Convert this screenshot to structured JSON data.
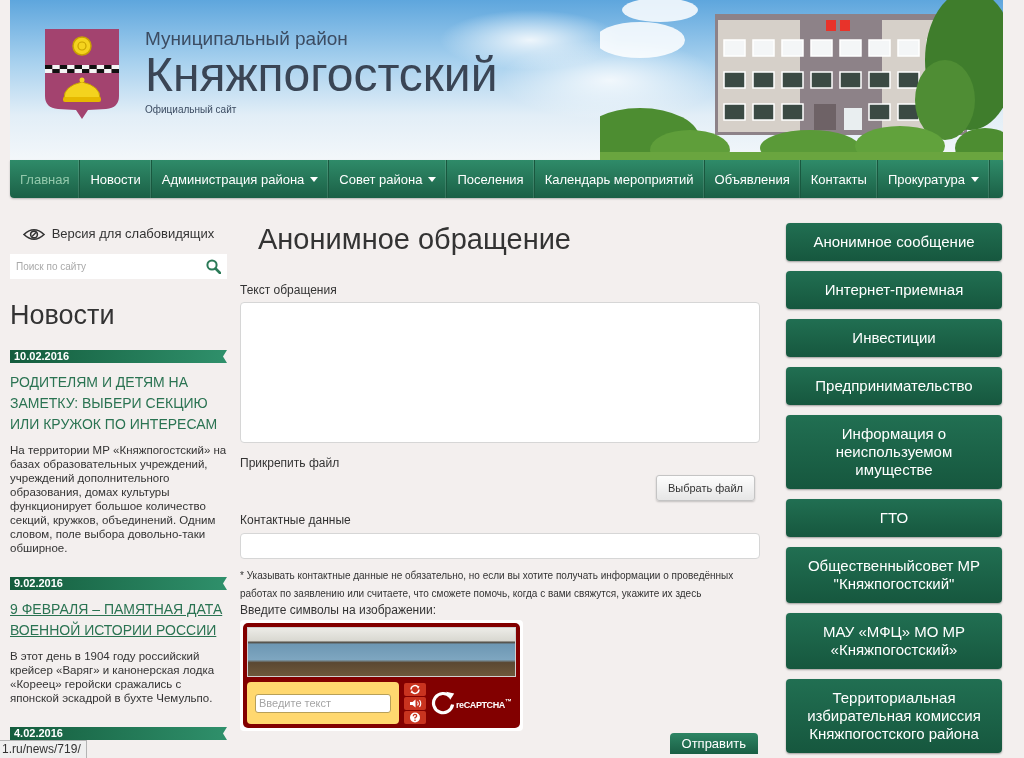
{
  "header": {
    "subtitle": "Муниципальный район",
    "title": "Княжпогостский",
    "tagline": "Официальный сайт"
  },
  "nav": [
    {
      "label": "Главная",
      "selected": true,
      "dropdown": false
    },
    {
      "label": "Новости",
      "selected": false,
      "dropdown": false
    },
    {
      "label": "Администрация района",
      "selected": false,
      "dropdown": true
    },
    {
      "label": "Совет района",
      "selected": false,
      "dropdown": true
    },
    {
      "label": "Поселения",
      "selected": false,
      "dropdown": false
    },
    {
      "label": "Календарь мероприятий",
      "selected": false,
      "dropdown": false
    },
    {
      "label": "Объявления",
      "selected": false,
      "dropdown": false
    },
    {
      "label": "Контакты",
      "selected": false,
      "dropdown": false
    },
    {
      "label": "Прокуратура",
      "selected": false,
      "dropdown": true
    }
  ],
  "left_sidebar": {
    "low_vision_link": "Версия для слабовидящих",
    "search": {
      "placeholder": "Поиск по сайту"
    },
    "news_heading": "Новости",
    "news": [
      {
        "date": "10.02.2016",
        "title": "РОДИТЕЛЯМ И ДЕТЯМ НА ЗАМЕТКУ: ВЫБЕРИ СЕКЦИЮ ИЛИ КРУЖОК ПО ИНТЕРЕСАМ",
        "hovered": false,
        "summary": "На территории МР «Княжпогостский» на базах образовательных учреждений, учреждений дополнительного образования, домах культуры функционирует большое количество секций, кружков, объединений. Одним словом, поле выбора довольно-таки обширное."
      },
      {
        "date": "9.02.2016",
        "title": "9 ФЕВРАЛЯ – ПАМЯТНАЯ ДАТА ВОЕННОЙ ИСТОРИИ РОССИИ",
        "hovered": true,
        "summary": "В этот день в 1904 году российский крейсер «Варяг» и канонерская лодка «Кореец» геройски сражались с японской эскадрой в бухте Чемульпо."
      },
      {
        "date": "4.02.2016"
      }
    ]
  },
  "form": {
    "title": "Анонимное обращение",
    "fields": [
      {
        "kind": "textarea",
        "label": "Текст обращения"
      },
      {
        "kind": "file",
        "label": "Прикрепить файл",
        "button": "Выбрать файл"
      },
      {
        "kind": "input",
        "label": "Контактные данные"
      }
    ],
    "note": "* Указывать контактные данные не обязательно, но если вы хотите получать информации о проведённых работах по заявлению или считаете, что сможете помочь, когда с вами свяжутся, укажите их здесь",
    "captcha": {
      "label": "Введите символы на изображении:",
      "placeholder": "Введите текст",
      "logo": "reCAPTCHA$^{™}$"
    },
    "submit": "Отправить"
  },
  "right_sidebar": {
    "links": [
      "Анонимное сообщение",
      "Интернет-приемная",
      "Инвестиции",
      "Предпринимательство",
      "Информация о неиспользуемом имуществе",
      "ГТО",
      "Общественныйсовет МР \"Княжпогостский\"",
      "МАУ «МФЦ» МО МР «Княжпогостский»",
      "Территориальная избирательная комиссия Княжпогостского района"
    ]
  },
  "status_bar": {
    "url": "1.ru/news/719/"
  }
}
